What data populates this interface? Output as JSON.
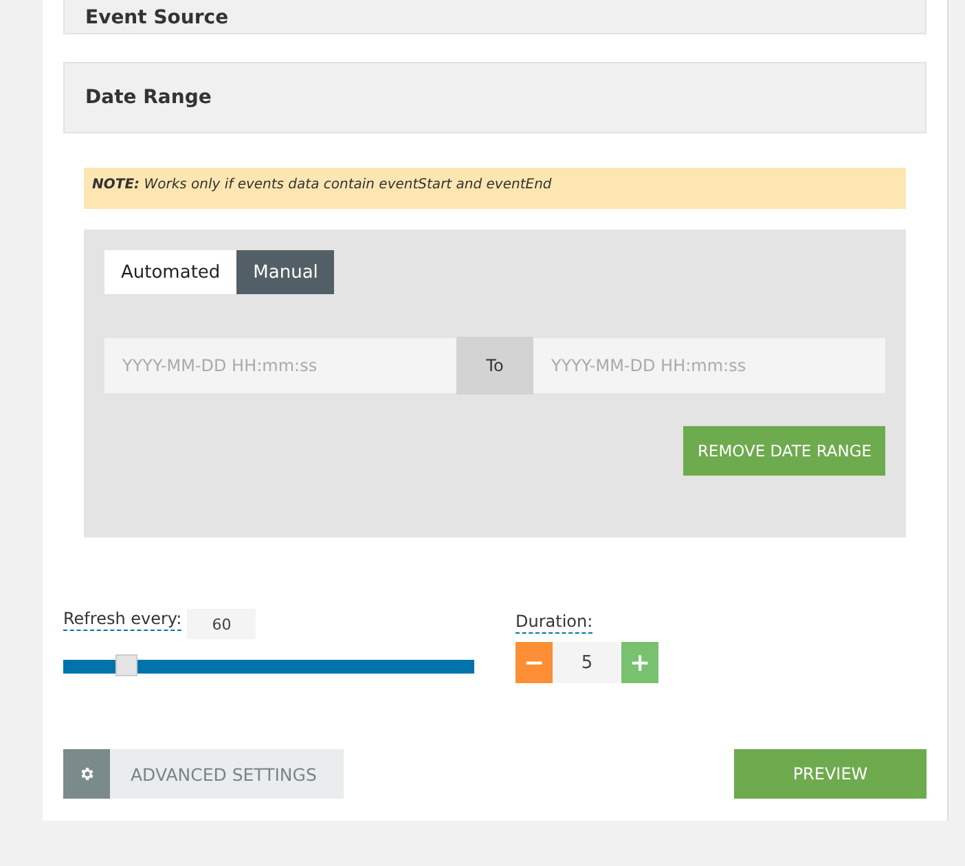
{
  "sections": [
    {
      "title": "Event Source"
    },
    {
      "title": "Date Range"
    }
  ],
  "note": "**NOTE:** Works only if events data contain eventStart and eventEnd",
  "mode_tabs": [
    {
      "label": "Automated",
      "selected": false
    },
    {
      "label": "Manual",
      "selected": true
    }
  ],
  "date_from": {
    "placeholder": "YYYY-MM-DD HH:mm:ss"
  },
  "to_label": "To",
  "date_to": {
    "placeholder": "YYYY-MM-DD HH:mm:ss"
  },
  "remove_button": "REMOVE DATE RANGE",
  "refresh": {
    "label": "Refresh every:",
    "value": "60",
    "level": 0.15
  },
  "duration": {
    "label": "Duration:",
    "minus": "−",
    "value": "5",
    "plus": "+"
  },
  "advanced_button": "ADVANCED SETTINGS",
  "preview_button": "PREVIEW"
}
